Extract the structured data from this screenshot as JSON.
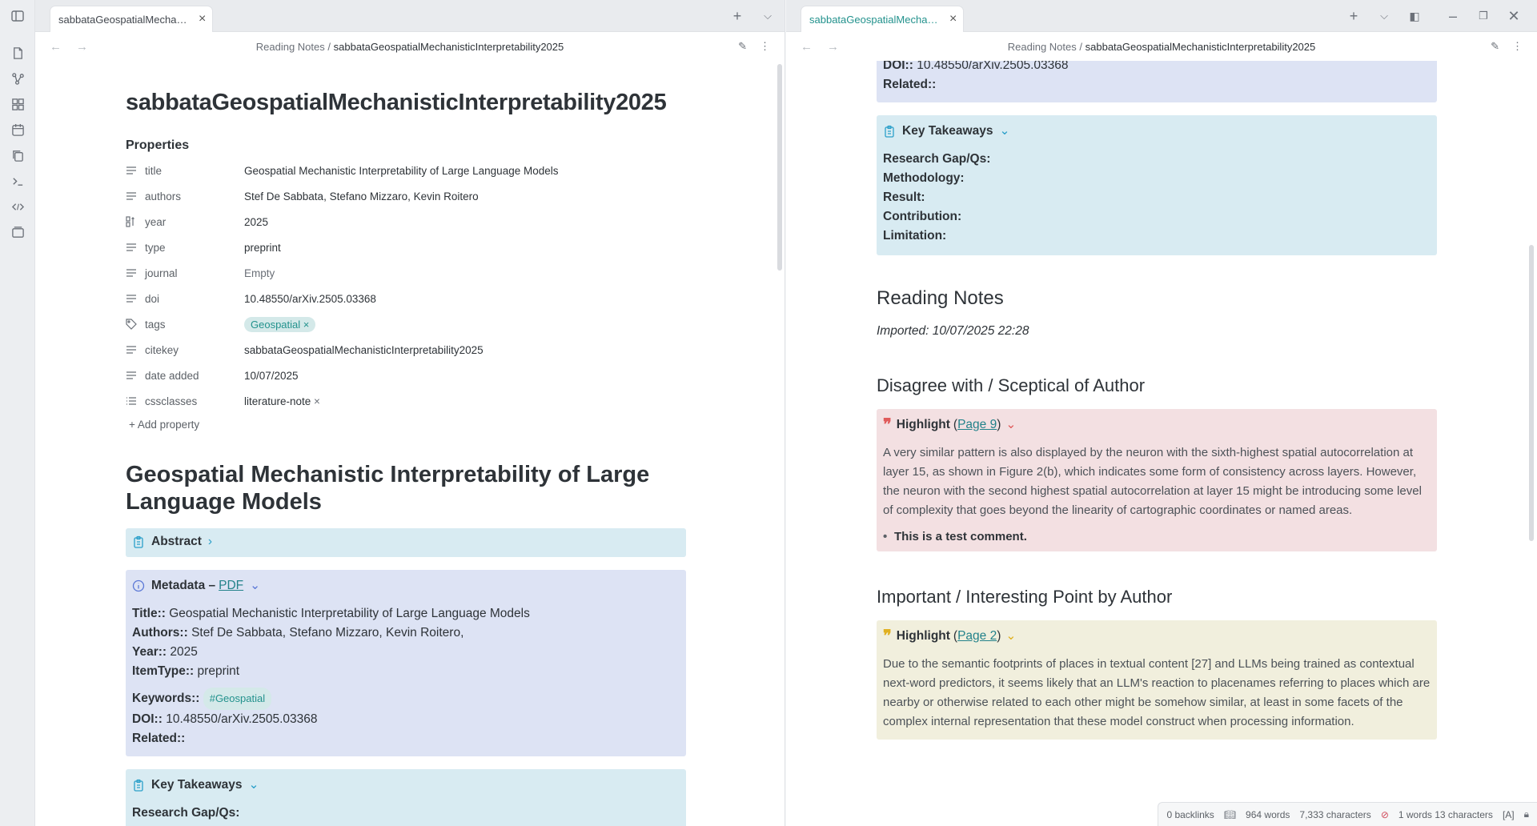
{
  "ribbon": {
    "icons": [
      "sidebar-toggle-icon",
      "new-note-icon",
      "graph-icon",
      "canvas-icon",
      "daily-note-icon",
      "templates-icon",
      "terminal-icon",
      "code-icon",
      "slides-icon"
    ]
  },
  "left": {
    "tab_title": "sabbataGeospatialMechan...",
    "breadcrumb_folder": "Reading Notes",
    "breadcrumb_sep": "/",
    "breadcrumb_file": "sabbataGeospatialMechanisticInterpretability2025",
    "note_title": "sabbataGeospatialMechanisticInterpretability2025",
    "properties_heading": "Properties",
    "properties": [
      {
        "key": "title",
        "value": "Geospatial Mechanistic Interpretability of Large Language Models",
        "icon": "text-icon"
      },
      {
        "key": "authors",
        "value": "Stef De Sabbata, Stefano Mizzaro, Kevin Roitero",
        "icon": "text-icon"
      },
      {
        "key": "year",
        "value": "2025",
        "icon": "number-icon"
      },
      {
        "key": "type",
        "value": "preprint",
        "icon": "text-icon"
      },
      {
        "key": "journal",
        "value": "Empty",
        "icon": "text-icon"
      },
      {
        "key": "doi",
        "value": "10.48550/arXiv.2505.03368",
        "icon": "text-icon"
      },
      {
        "key": "tags",
        "value": "Geospatial",
        "icon": "tag-icon"
      },
      {
        "key": "citekey",
        "value": "sabbataGeospatialMechanisticInterpretability2025",
        "icon": "text-icon"
      },
      {
        "key": "date added",
        "value": "10/07/2025",
        "icon": "text-icon"
      },
      {
        "key": "cssclasses",
        "value": "literature-note",
        "icon": "list-icon"
      }
    ],
    "add_property": "Add property",
    "heading": "Geospatial Mechanistic Interpretability of Large Language Models",
    "abstract_title": "Abstract",
    "metadata_title": "Metadata –",
    "metadata_link": "PDF",
    "meta": {
      "title_k": "Title::",
      "title_v": "Geospatial Mechanistic Interpretability of Large Language Models",
      "authors_k": "Authors::",
      "authors_v": "Stef De Sabbata, Stefano Mizzaro, Kevin Roitero,",
      "year_k": "Year::",
      "year_v": "2025",
      "itemtype_k": "ItemType::",
      "itemtype_v": "preprint",
      "keywords_k": "Keywords::",
      "keywords_v": "#Geospatial",
      "doi_k": "DOI::",
      "doi_v": "10.48550/arXiv.2505.03368",
      "related_k": "Related::"
    },
    "key_title": "Key Takeaways",
    "key_first": "Research Gap/Qs:"
  },
  "right": {
    "tab_title": "sabbataGeospatialMechan...",
    "breadcrumb_folder": "Reading Notes",
    "breadcrumb_sep": "/",
    "breadcrumb_file": "sabbataGeospatialMechanisticInterpretability2025",
    "doi_k": "DOI::",
    "doi_v": "10.48550/arXiv.2505.03368",
    "related_k": "Related::",
    "key_title": "Key Takeaways",
    "key_items": [
      "Research Gap/Qs:",
      "Methodology:",
      "Result:",
      "Contribution:",
      "Limitation:"
    ],
    "reading_notes_heading": "Reading Notes",
    "imported": "Imported: 10/07/2025 22:28",
    "disagree_heading": "Disagree with / Sceptical of Author",
    "hl1_label": "Highlight",
    "hl1_open": "(",
    "hl1_page": "Page 9",
    "hl1_close": ")",
    "hl1_text": "A very similar pattern is also displayed by the neuron with the sixth-highest spatial autocorrelation at layer 15, as shown in Figure 2(b), which indicates some form of consistency across layers. However, the neuron with the second highest spatial autocorrelation at layer 15 might be introducing some level of complexity that goes beyond the linearity of cartographic coordinates or named areas.",
    "hl1_comment": "This is a test comment.",
    "important_heading": "Important / Interesting Point by Author",
    "hl2_label": "Highlight",
    "hl2_open": "(",
    "hl2_page": "Page 2",
    "hl2_close": ")",
    "hl2_text": "Due to the semantic footprints of places in textual content [27] and LLMs being trained as contextual next-word predictors, it seems likely that an LLM's reaction to placenames referring to places which are nearby or otherwise related to each other might be somehow similar, at least in some facets of the complex internal representation that these model construct when processing information."
  },
  "status": {
    "backlinks": "0 backlinks",
    "words": "964 words",
    "characters": "7,333 characters",
    "selection": "1 words 13 characters",
    "lang": "[A]"
  },
  "colors": {
    "accent": "#23928d",
    "callout_blue": "#d8ebf2",
    "callout_purple": "#dde3f4",
    "callout_red": "#f3e0e2",
    "callout_yellow": "#f1efdd",
    "quote_red": "#e05b5b",
    "quote_yellow": "#e0b020"
  }
}
